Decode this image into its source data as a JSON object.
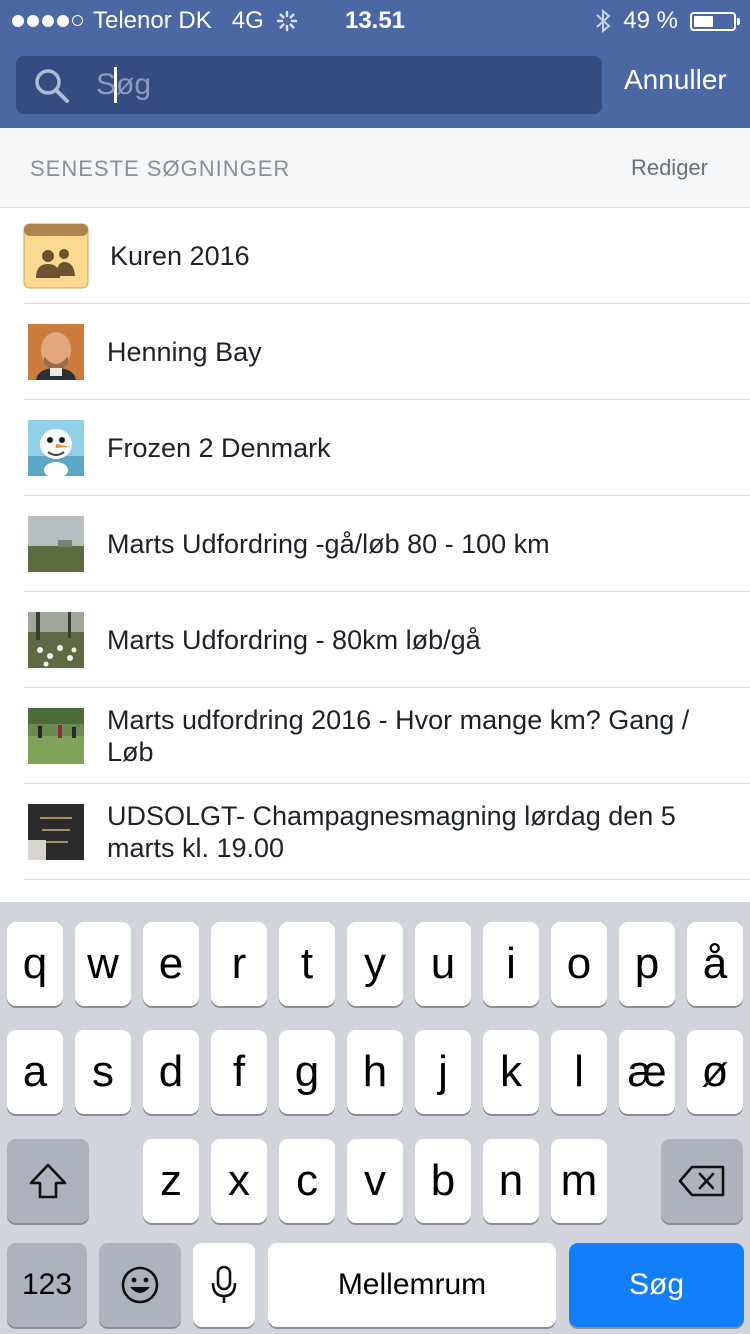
{
  "status_bar": {
    "carrier": "Telenor DK",
    "network": "4G",
    "time": "13.51",
    "battery": "49 %",
    "battery_level": 0.49
  },
  "search": {
    "placeholder": "Søg",
    "value": "",
    "cancel_label": "Annuller"
  },
  "recent": {
    "title": "SENESTE SØGNINGER",
    "edit_label": "Rediger",
    "items": [
      {
        "label": "Kuren 2016",
        "thumb": "group-icon"
      },
      {
        "label": "Henning Bay",
        "thumb": "profile-photo"
      },
      {
        "label": "Frozen 2 Denmark",
        "thumb": "snowman-photo"
      },
      {
        "label": "Marts Udfordring -gå/løb 80 - 100 km",
        "thumb": "field-photo"
      },
      {
        "label": "Marts Udfordring - 80km løb/gå",
        "thumb": "flowers-photo"
      },
      {
        "label": "Marts udfordring 2016 - Hvor mange km? Gang / Løb",
        "thumb": "runners-photo"
      },
      {
        "label": "UDSOLGT- Champagnesmagning lørdag den 5 marts kl. 19.00",
        "thumb": "champagne-photo"
      }
    ]
  },
  "keyboard": {
    "row1": [
      "q",
      "w",
      "e",
      "r",
      "t",
      "y",
      "u",
      "i",
      "o",
      "p",
      "å"
    ],
    "row2": [
      "a",
      "s",
      "d",
      "f",
      "g",
      "h",
      "j",
      "k",
      "l",
      "æ",
      "ø"
    ],
    "row3": [
      "z",
      "x",
      "c",
      "v",
      "b",
      "n",
      "m"
    ],
    "numbers_label": "123",
    "space_label": "Mellemrum",
    "search_label": "Søg"
  }
}
